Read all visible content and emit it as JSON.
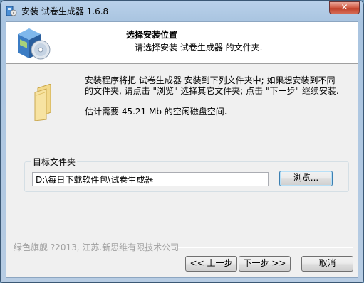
{
  "window": {
    "title": "安装 试卷生成器 1.6.8",
    "close_label": "✕"
  },
  "header": {
    "title": "选择安装位置",
    "subtitle": "请选择安装 试卷生成器 的文件夹."
  },
  "body": {
    "description_line1": "安装程序将把 试卷生成器 安装到下列文件夹中; 如果想安装到不同",
    "description_line2": "的文件夹, 请点击 \"浏览\" 选择其它文件夹; 点击 \"下一步\" 继续安装.",
    "space_required": "估计需要 45.21 Mb 的空闲磁盘空间."
  },
  "target": {
    "group_label": "目标文件夹",
    "path_value": "D:\\每日下载软件包\\试卷生成器",
    "browse_label": "浏览..."
  },
  "footer": {
    "brand": "绿色旗舰 ?2013, 江苏.新思维有限技术公司",
    "back_label": "<< 上一步",
    "next_label": "下一步 >>",
    "cancel_label": "取消"
  },
  "colors": {
    "title_bar": "#b9d1ea",
    "close_button": "#c0412b",
    "header_bg": "#ffffff",
    "client_bg": "#f0f0f0"
  },
  "icons": {
    "app": "installer-icon",
    "header": "software-box-icon",
    "folder": "folder-icon"
  }
}
